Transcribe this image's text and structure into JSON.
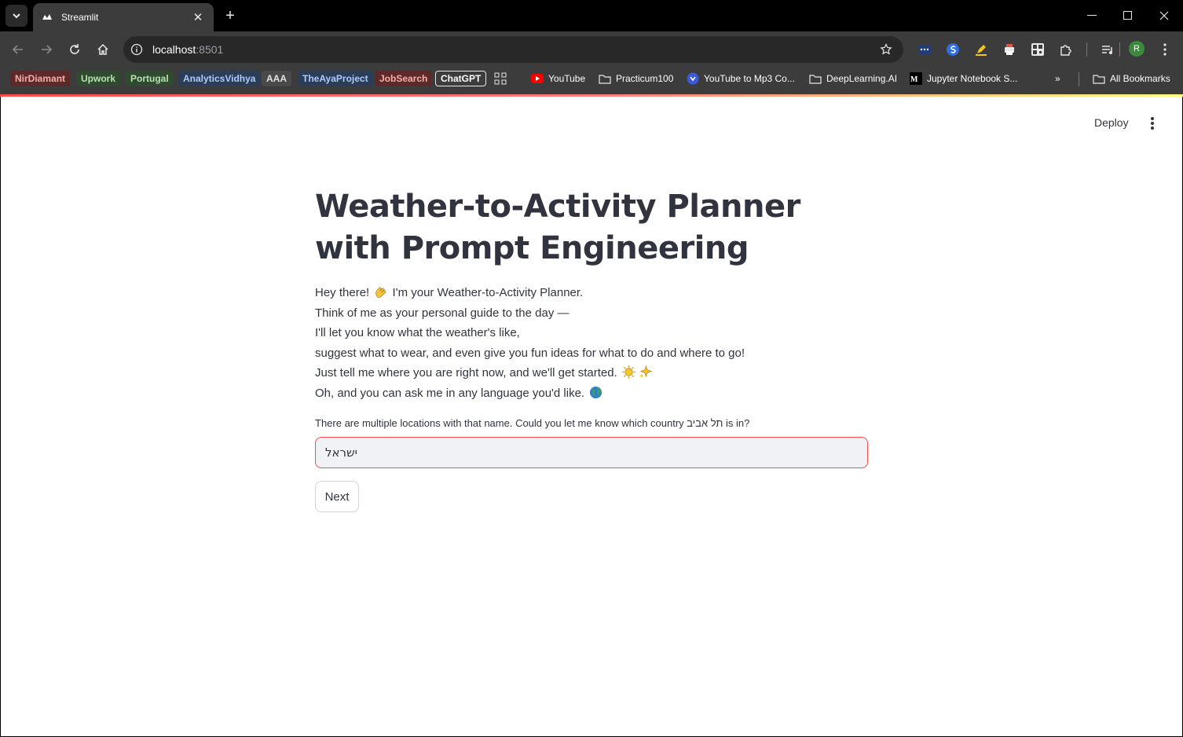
{
  "browser": {
    "tab_title": "Streamlit",
    "url_host": "localhost",
    "url_port": ":8501",
    "bookmarks_chips": [
      {
        "label": "NirDiamant",
        "bg": "#5c2b29",
        "fg": "#f6aea9"
      },
      {
        "label": "Upwork",
        "bg": "#2f4a2f",
        "fg": "#b7e1b1"
      },
      {
        "label": "Portugal",
        "bg": "#2f4a2f",
        "fg": "#b7e1b1"
      },
      {
        "label": "AnalyticsVidhya",
        "bg": "#2c3e57",
        "fg": "#aecbfa"
      },
      {
        "label": "AAA",
        "bg": "#4a4a4a",
        "fg": "#e3e3e3"
      },
      {
        "label": "TheAyaProject",
        "bg": "#2c3e57",
        "fg": "#aecbfa"
      },
      {
        "label": "JobSearch",
        "bg": "#5c2b29",
        "fg": "#f6aea9"
      },
      {
        "label": "ChatGPT",
        "bg": "#3c3c3c",
        "fg": "#ffffff"
      }
    ],
    "bookmarks": {
      "youtube": "YouTube",
      "practicum": "Practicum100",
      "yt_mp3": "YouTube to Mp3 Co...",
      "deeplearning": "DeepLearning.AI",
      "jupyter": "Jupyter Notebook S...",
      "all": "All Bookmarks"
    },
    "avatar_letter": "R"
  },
  "app": {
    "deploy_label": "Deploy",
    "title": "Weather-to-Activity Planner with Prompt Engineering",
    "intro": {
      "l1a": "Hey there!",
      "l1b": "I'm your Weather-to-Activity Planner.",
      "l2": "Think of me as your personal guide to the day —",
      "l3": "I'll let you know what the weather's like,",
      "l4": "suggest what to wear, and even give you fun ideas for what to do and where to go!",
      "l5": "Just tell me where you are right now, and we'll get started.",
      "l6": "Oh, and you can ask me in any language you'd like."
    },
    "question": "There are multiple locations with that name. Could you let me know which country תל אביב is in?",
    "input_value": "ישראל",
    "next_label": "Next"
  }
}
